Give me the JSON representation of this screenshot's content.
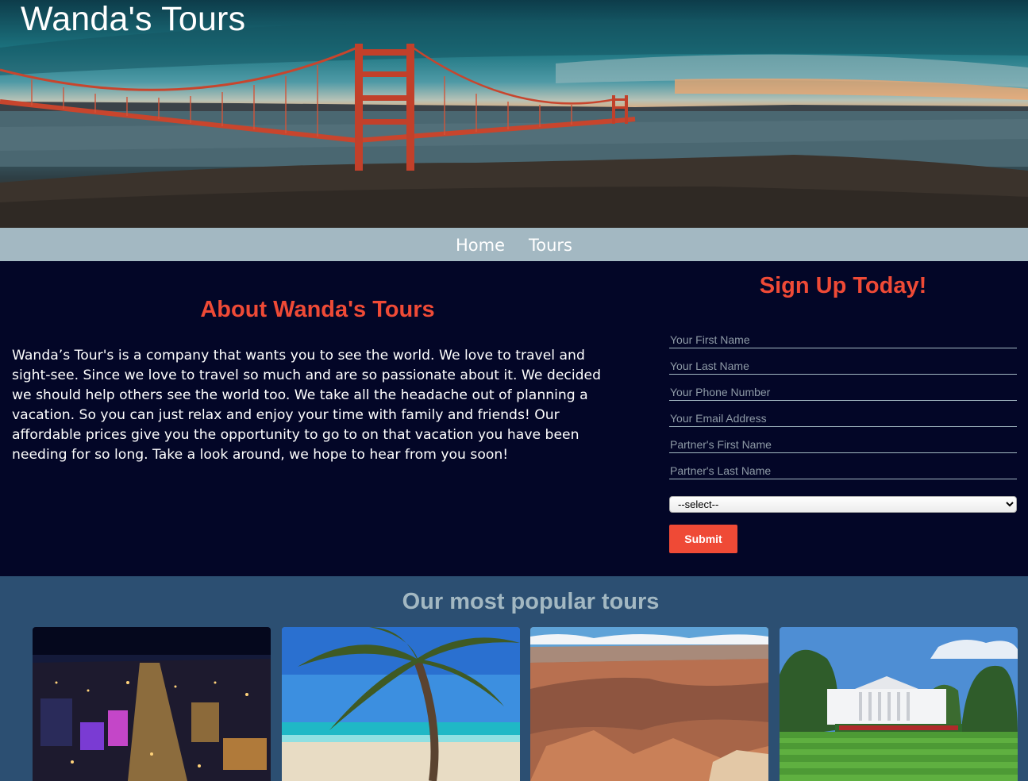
{
  "site": {
    "title": "Wanda's Tours"
  },
  "nav": {
    "items": [
      "Home",
      "Tours"
    ]
  },
  "about": {
    "heading": "About Wanda's Tours",
    "text": "Wanda’s Tour's is a company that wants you to see the world. We love to travel and sight-see. Since we love to travel so much and are so passionate about it. We decided we should help others see the world too. We take all the headache out of planning a vacation. So you can just relax and enjoy your time with family and friends! Our affordable prices give you the opportunity to go to on that vacation you have been needing for so long. Take a look around, we hope to hear from you soon!"
  },
  "signup": {
    "heading": "Sign Up Today!",
    "fields": [
      {
        "placeholder": "Your First Name",
        "value": ""
      },
      {
        "placeholder": "Your Last Name",
        "value": ""
      },
      {
        "placeholder": "Your Phone Number",
        "value": ""
      },
      {
        "placeholder": "Your Email Address",
        "value": ""
      },
      {
        "placeholder": "Partner's First Name",
        "value": ""
      },
      {
        "placeholder": "Partner's Last Name",
        "value": ""
      }
    ],
    "select": {
      "selected": "--select--"
    },
    "submit_label": "Submit"
  },
  "popular": {
    "heading": "Our most popular tours",
    "tours": [
      {
        "image": "las-vegas-night-skyline-image"
      },
      {
        "image": "tropical-beach-palm-image"
      },
      {
        "image": "grand-canyon-image"
      },
      {
        "image": "white-house-image"
      }
    ]
  },
  "colors": {
    "accent": "#ef4a36",
    "nav_bg": "#a3b8c2",
    "main_bg": "#030627",
    "tours_bg": "#2c4f72"
  }
}
